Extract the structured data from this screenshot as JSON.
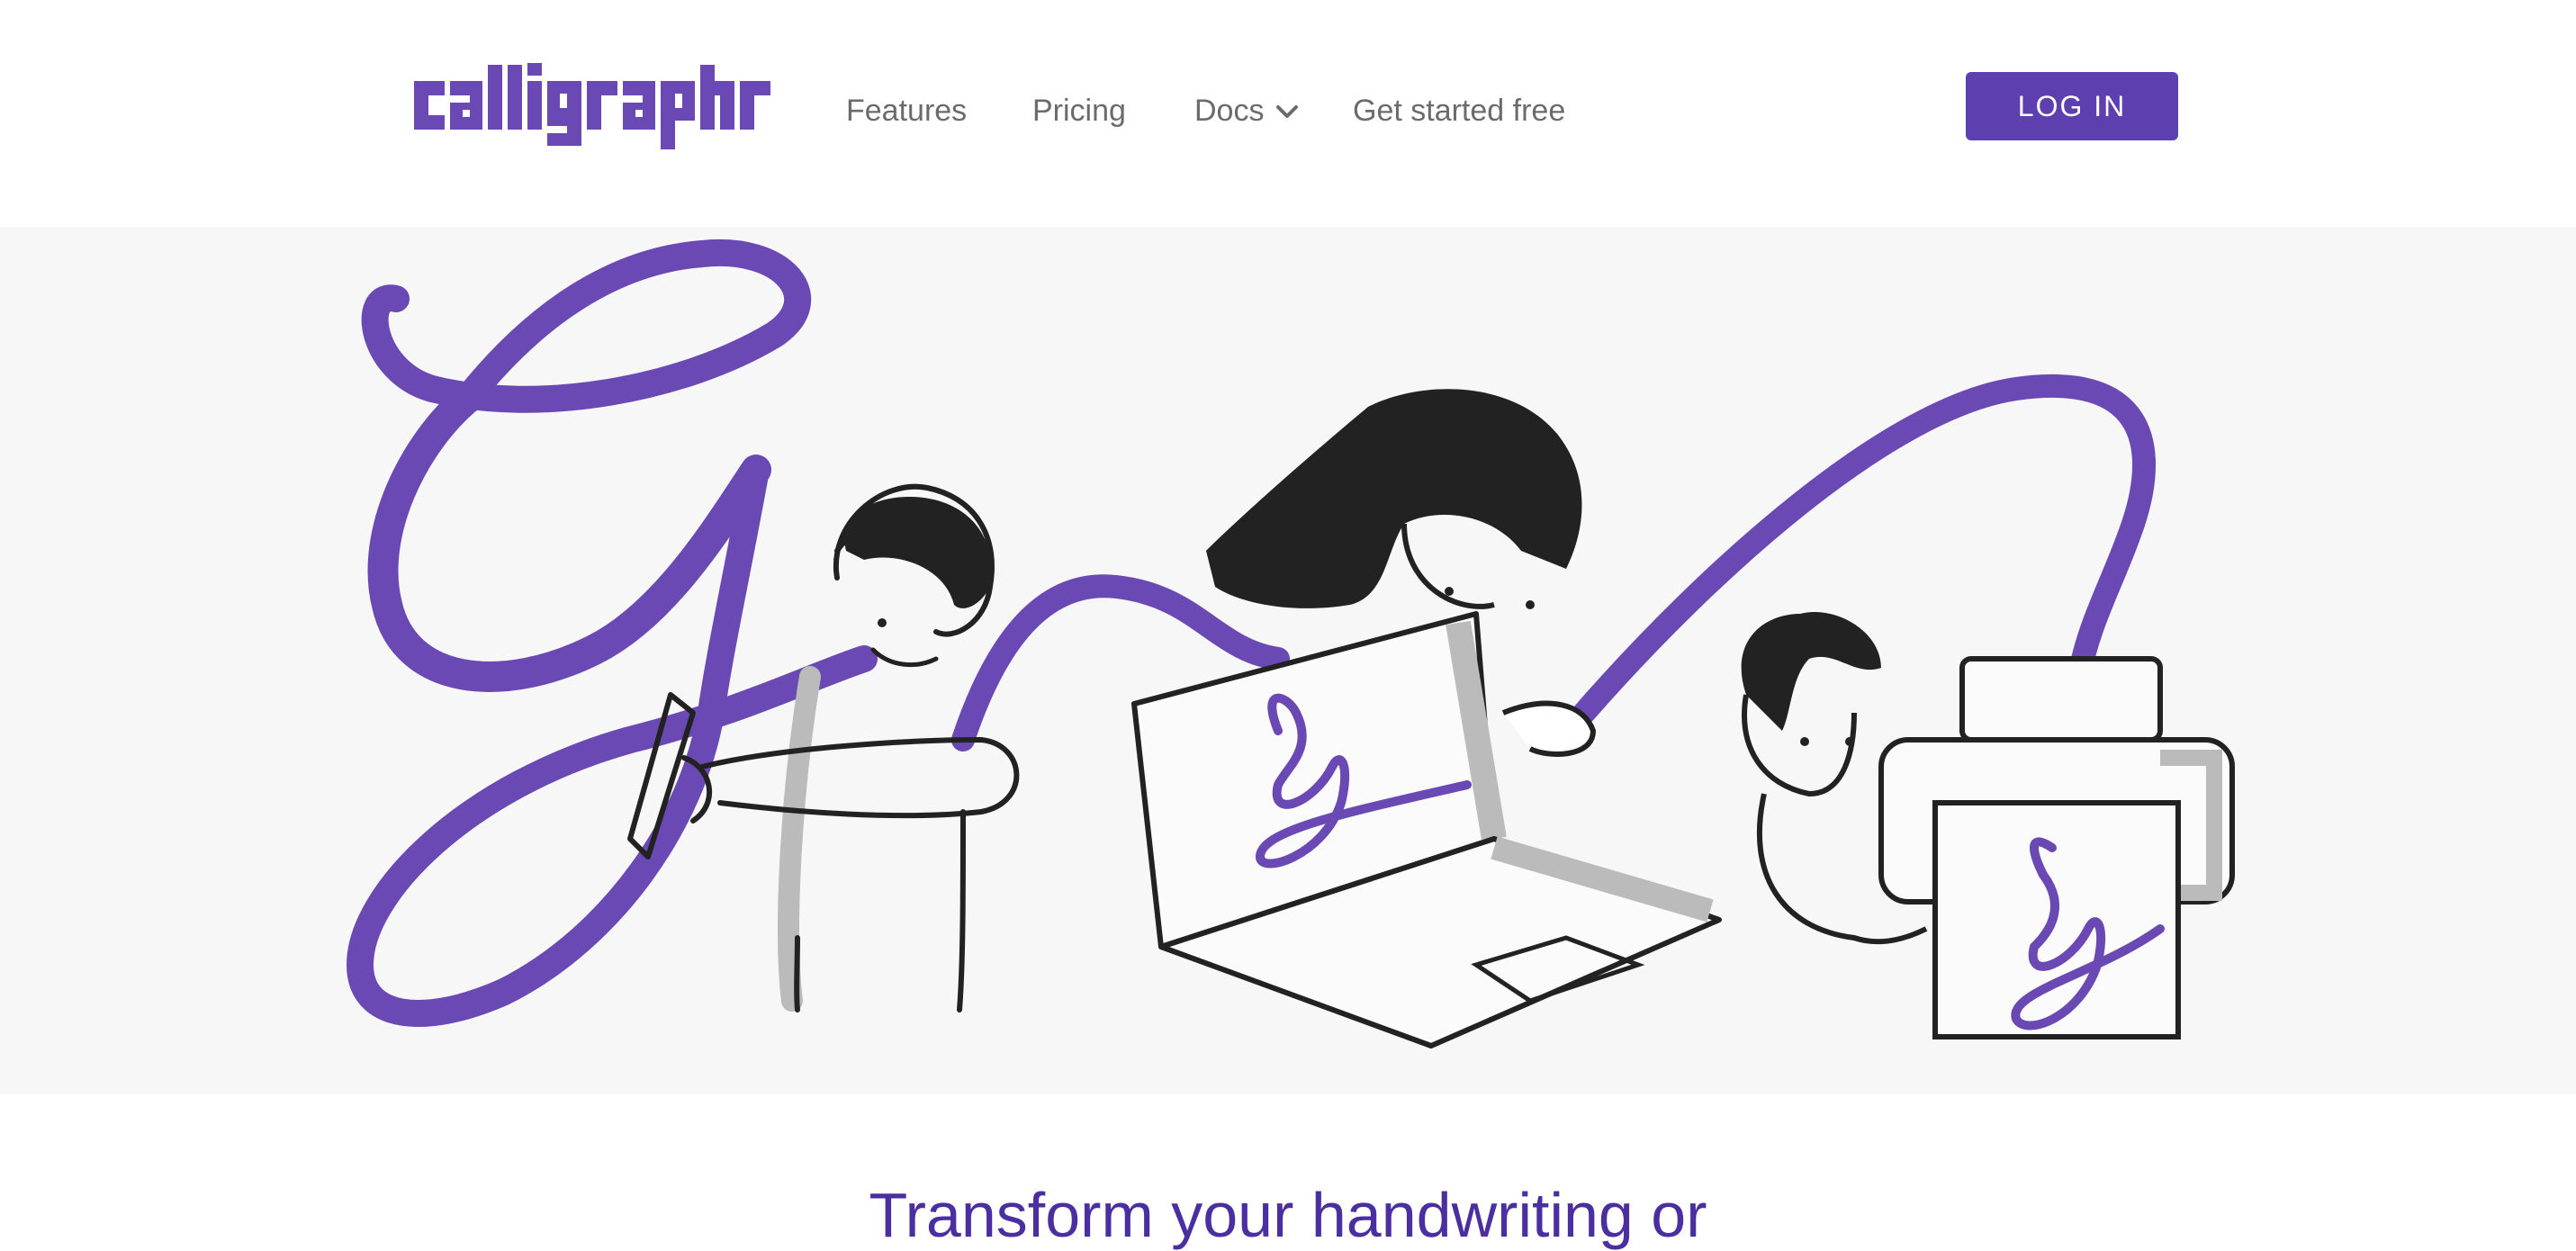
{
  "brand": {
    "name": "calligraphr",
    "accent": "#5e3fb0"
  },
  "nav": {
    "features": "Features",
    "pricing": "Pricing",
    "docs": "Docs",
    "docs_icon": "chevron-down-icon",
    "get_started": "Get started free"
  },
  "login": {
    "label": "LOG IN"
  },
  "hero": {
    "illustration": "hero-illustration",
    "headline": "Transform your handwriting or"
  }
}
